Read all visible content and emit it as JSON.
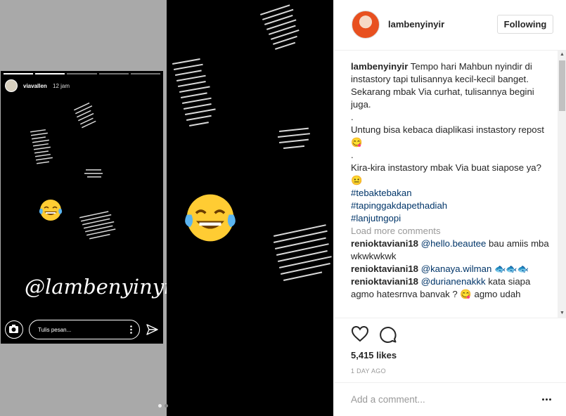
{
  "story": {
    "username": "viavallen",
    "time": "12 jam",
    "handle": "@lambenyinyir",
    "message_placeholder": "Tulis pesan..."
  },
  "post": {
    "owner": "lambenyinyir",
    "follow_label": "Following",
    "caption_lines": [
      "Tempo hari Mahbun nyindir di instastory tapi tulisannya kecil-kecil banget. Sekarang mbak Via curhat, tulisannya begini juga.",
      ".",
      "Untung bisa kebaca diaplikasi instastory repost 😋",
      ".",
      "Kira-kira instastory mbak Via buat siapose ya? 😐"
    ],
    "hashtags": [
      "#tebaktebakan",
      "#tapinggakdapethadiah",
      "#lanjutngopi"
    ],
    "load_more": "Load more comments",
    "comments": [
      {
        "user": "renioktaviani18",
        "mention": "@hello.beautee",
        "text": " bau amiis mba wkwkwkwk"
      },
      {
        "user": "renioktaviani18",
        "mention": "@kanaya.wilman",
        "text": " 🐟🐟🐟"
      },
      {
        "user": "renioktaviani18",
        "mention": "@durianenakkk",
        "text": " kata siapa agmo hatesrnva banvak ? 😋 agmo udah"
      }
    ],
    "likes": "5,415 likes",
    "posted": "1 DAY AGO",
    "add_comment_placeholder": "Add a comment..."
  },
  "colors": {
    "link": "#003569",
    "muted": "#999999",
    "text": "#262626"
  }
}
